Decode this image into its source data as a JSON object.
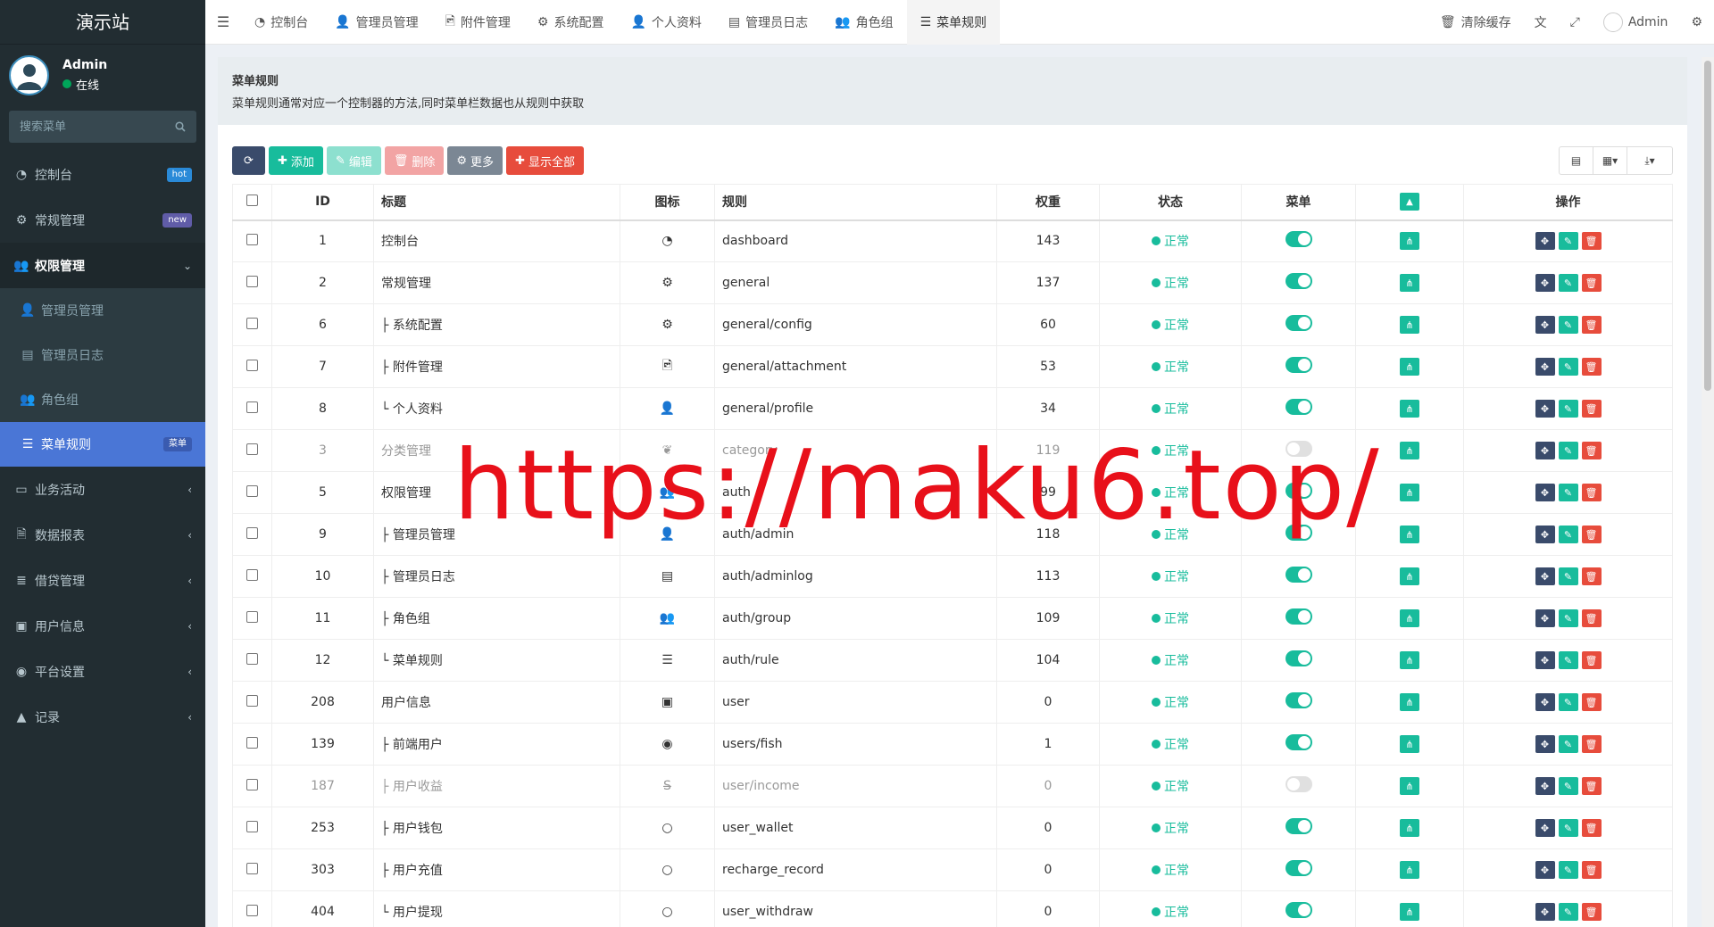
{
  "app": {
    "brand": "演示站"
  },
  "user": {
    "name": "Admin",
    "status": "在线"
  },
  "search": {
    "placeholder": "搜索菜单"
  },
  "sidebar": {
    "items": [
      {
        "label": "控制台",
        "badge": "hot",
        "icon": "dashboard-icon"
      },
      {
        "label": "常规管理",
        "badge": "new",
        "icon": "cogs-icon"
      },
      {
        "label": "权限管理",
        "icon": "group-icon",
        "open": true
      },
      {
        "label": "业务活动",
        "icon": "card-icon"
      },
      {
        "label": "数据报表",
        "icon": "file-icon"
      },
      {
        "label": "借贷管理",
        "icon": "list-icon"
      },
      {
        "label": "用户信息",
        "icon": "contact-icon"
      },
      {
        "label": "平台设置",
        "icon": "circle-dot-icon"
      },
      {
        "label": "记录",
        "icon": "area-chart-icon"
      }
    ],
    "subitems": [
      {
        "label": "管理员管理",
        "icon": "user-icon"
      },
      {
        "label": "管理员日志",
        "icon": "list-alt-icon"
      },
      {
        "label": "角色组",
        "icon": "group-icon"
      },
      {
        "label": "菜单规则",
        "icon": "bars-icon",
        "badge": "菜单",
        "active": true
      }
    ]
  },
  "tabs": [
    {
      "label": "控制台",
      "icon": "dashboard-icon"
    },
    {
      "label": "管理员管理",
      "icon": "user-icon"
    },
    {
      "label": "附件管理",
      "icon": "file-image-icon"
    },
    {
      "label": "系统配置",
      "icon": "cog-icon"
    },
    {
      "label": "个人资料",
      "icon": "user-icon"
    },
    {
      "label": "管理员日志",
      "icon": "list-alt-icon"
    },
    {
      "label": "角色组",
      "icon": "group-icon"
    },
    {
      "label": "菜单规则",
      "icon": "bars-icon",
      "active": true
    }
  ],
  "topright": {
    "clear_cache": "清除缓存",
    "admin": "Admin"
  },
  "page": {
    "title": "菜单规则",
    "desc": "菜单规则通常对应一个控制器的方法,同时菜单栏数据也从规则中获取"
  },
  "toolbar": {
    "add": "添加",
    "edit": "编辑",
    "delete": "删除",
    "more": "更多",
    "show_all": "显示全部"
  },
  "table": {
    "headers": [
      "ID",
      "标题",
      "图标",
      "规则",
      "权重",
      "状态",
      "菜单",
      "操作"
    ],
    "rows": [
      {
        "id": "1",
        "title": "控制台",
        "icon": "dashboard-icon",
        "rule": "dashboard",
        "weigh": "143",
        "status": "正常",
        "menu": true
      },
      {
        "id": "2",
        "title": "常规管理",
        "icon": "cogs-icon",
        "rule": "general",
        "weigh": "137",
        "status": "正常",
        "menu": true
      },
      {
        "id": "6",
        "title": "├ 系统配置",
        "icon": "cog-icon",
        "rule": "general/config",
        "weigh": "60",
        "status": "正常",
        "menu": true
      },
      {
        "id": "7",
        "title": "├ 附件管理",
        "icon": "file-image-icon",
        "rule": "general/attachment",
        "weigh": "53",
        "status": "正常",
        "menu": true
      },
      {
        "id": "8",
        "title": "└ 个人资料",
        "icon": "user-icon",
        "rule": "general/profile",
        "weigh": "34",
        "status": "正常",
        "menu": true
      },
      {
        "id": "3",
        "title": "分类管理",
        "icon": "leaf-icon",
        "rule": "category",
        "weigh": "119",
        "status": "正常",
        "menu": false
      },
      {
        "id": "5",
        "title": "权限管理",
        "icon": "group-icon",
        "rule": "auth",
        "weigh": "99",
        "status": "正常",
        "menu": true
      },
      {
        "id": "9",
        "title": "├ 管理员管理",
        "icon": "user-icon",
        "rule": "auth/admin",
        "weigh": "118",
        "status": "正常",
        "menu": true
      },
      {
        "id": "10",
        "title": "├ 管理员日志",
        "icon": "list-alt-icon",
        "rule": "auth/adminlog",
        "weigh": "113",
        "status": "正常",
        "menu": true
      },
      {
        "id": "11",
        "title": "├ 角色组",
        "icon": "group-icon",
        "rule": "auth/group",
        "weigh": "109",
        "status": "正常",
        "menu": true
      },
      {
        "id": "12",
        "title": "└ 菜单规则",
        "icon": "bars-icon",
        "rule": "auth/rule",
        "weigh": "104",
        "status": "正常",
        "menu": true
      },
      {
        "id": "208",
        "title": "用户信息",
        "icon": "contact-icon",
        "rule": "user",
        "weigh": "0",
        "status": "正常",
        "menu": true
      },
      {
        "id": "139",
        "title": "├ 前端用户",
        "icon": "user-circle-icon",
        "rule": "users/fish",
        "weigh": "1",
        "status": "正常",
        "menu": true
      },
      {
        "id": "187",
        "title": "├ 用户收益",
        "icon": "strikethrough-icon",
        "rule": "user/income",
        "weigh": "0",
        "status": "正常",
        "menu": false
      },
      {
        "id": "253",
        "title": "├ 用户钱包",
        "icon": "circle-o-icon",
        "rule": "user_wallet",
        "weigh": "0",
        "status": "正常",
        "menu": true
      },
      {
        "id": "303",
        "title": "├ 用户充值",
        "icon": "circle-o-icon",
        "rule": "recharge_record",
        "weigh": "0",
        "status": "正常",
        "menu": true
      },
      {
        "id": "404",
        "title": "└ 用户提现",
        "icon": "circle-o-icon",
        "rule": "user_withdraw",
        "weigh": "0",
        "status": "正常",
        "menu": true
      }
    ]
  },
  "watermark": "https://maku6.top/",
  "colors": {
    "sidebar": "#222d32",
    "accent": "#18bc9c",
    "danger": "#e74c3c",
    "active_menu": "#4a76d6"
  }
}
